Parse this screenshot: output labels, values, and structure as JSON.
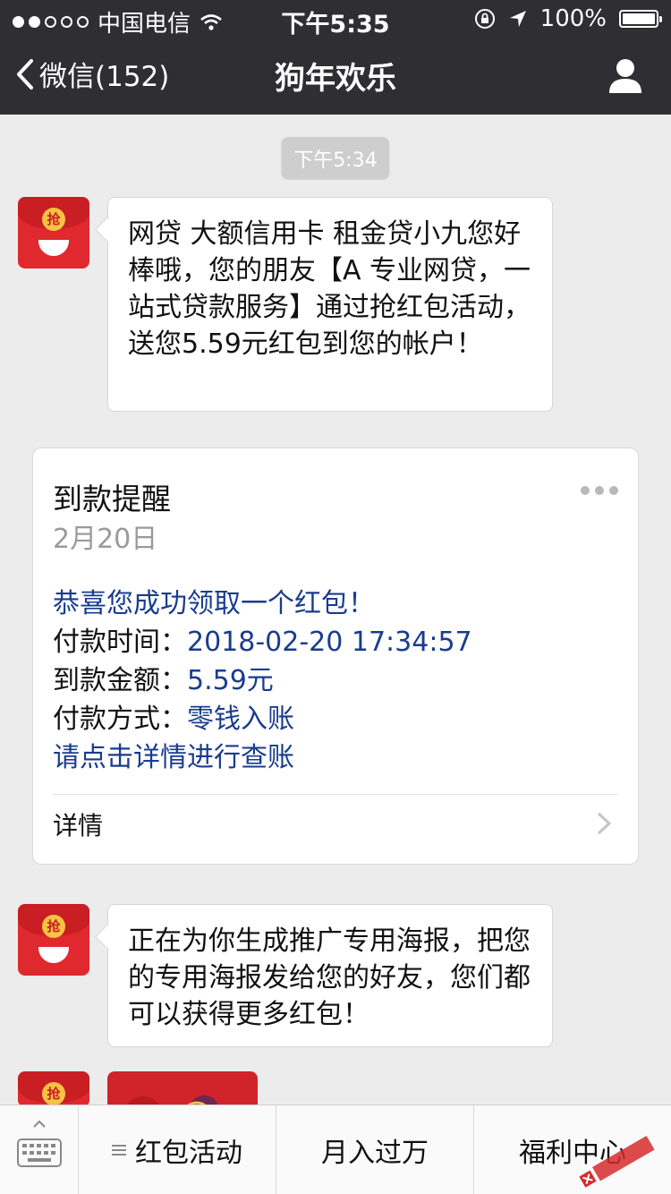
{
  "status_bar": {
    "carrier": "中国电信",
    "time": "下午5:35",
    "battery": "100%"
  },
  "nav": {
    "back_label": "微信(152)",
    "title": "狗年欢乐"
  },
  "chat": {
    "timestamp": "下午5:34",
    "messages": [
      {
        "sender_avatar": "red-envelope-avatar",
        "text": "网贷 大额信用卡 租金贷小九您好棒哦，您的朋友【A 专业网贷，一站式贷款服务】通过抢红包活动，送您5.59元红包到您的帐户！"
      },
      {
        "sender_avatar": "red-envelope-avatar",
        "text": "正在为你生成推广专用海报，把您的专用海报发给您的好友，您们都可以获得更多红包！"
      }
    ],
    "avatar_glyph": "抢"
  },
  "card": {
    "title": "到款提醒",
    "date": "2月20日",
    "greeting": "恭喜您成功领取一个红包！",
    "rows": [
      {
        "label": "付款时间：",
        "value": "2018-02-20 17:34:57"
      },
      {
        "label": "到款金额：",
        "value": "5.59元"
      },
      {
        "label": "付款方式：",
        "value": "零钱入账"
      }
    ],
    "check_link": "请点击详情进行查账",
    "detail_label": "详情"
  },
  "bottom_menu": {
    "items": [
      "红包活动",
      "月入过万",
      "福利中心"
    ]
  },
  "colors": {
    "nav_bg": "#2f2f33",
    "link_blue": "#1a3c8f",
    "envelope_red": "#e0292e"
  }
}
